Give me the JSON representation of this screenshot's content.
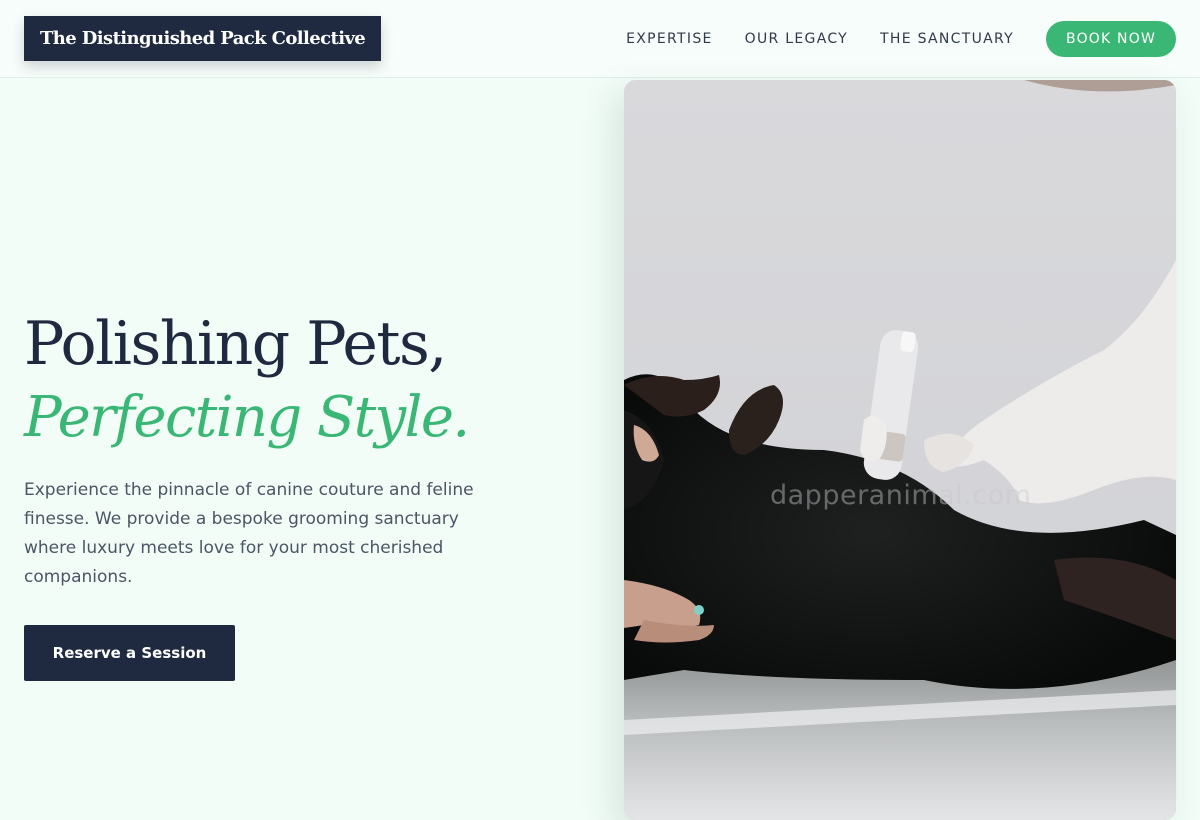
{
  "brand": {
    "name": "The Distinguished Pack Collective"
  },
  "nav": {
    "items": [
      "EXPERTISE",
      "OUR LEGACY",
      "THE SANCTUARY"
    ],
    "cta": "BOOK NOW"
  },
  "hero": {
    "title": "Polishing Pets,",
    "accent": "Perfecting Style.",
    "description": "Experience the pinnacle of canine couture and feline finesse. We provide a bespoke grooming sanctuary where luxury meets love for your most cherished companions.",
    "cta": "Reserve a Session"
  },
  "image": {
    "watermark": "dapperanimal.com"
  },
  "colors": {
    "navy": "#1f2a40",
    "green": "#3ab774",
    "background": "#f2fdf7"
  }
}
